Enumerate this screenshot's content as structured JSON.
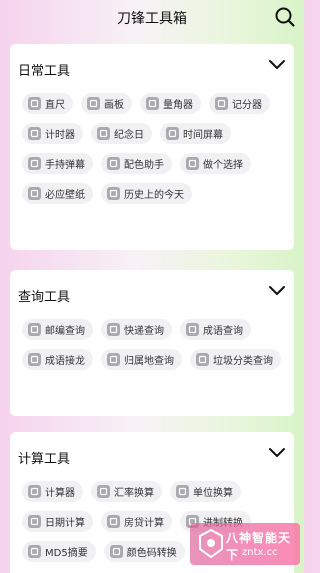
{
  "header": {
    "title": "刀锋工具箱",
    "search_icon": "search-icon"
  },
  "sections": {
    "daily": {
      "title": "日常工具",
      "items": [
        {
          "label": "直尺",
          "icon": "ruler-icon"
        },
        {
          "label": "画板",
          "icon": "palette-icon"
        },
        {
          "label": "量角器",
          "icon": "protractor-icon"
        },
        {
          "label": "记分器",
          "icon": "scoreboard-icon"
        },
        {
          "label": "计时器",
          "icon": "timer-icon"
        },
        {
          "label": "纪念日",
          "icon": "calendar-icon"
        },
        {
          "label": "时间屏幕",
          "icon": "clock-screen-icon"
        },
        {
          "label": "手持弹幕",
          "icon": "scrolling-text-icon"
        },
        {
          "label": "配色助手",
          "icon": "color-palette-icon"
        },
        {
          "label": "做个选择",
          "icon": "choice-icon"
        },
        {
          "label": "必应壁纸",
          "icon": "wallpaper-icon"
        },
        {
          "label": "历史上的今天",
          "icon": "history-icon"
        }
      ]
    },
    "query": {
      "title": "查询工具",
      "items": [
        {
          "label": "邮编查询",
          "icon": "postcode-icon"
        },
        {
          "label": "快递查询",
          "icon": "delivery-icon"
        },
        {
          "label": "成语查询",
          "icon": "book-icon"
        },
        {
          "label": "成语接龙",
          "icon": "idiom-chain-icon"
        },
        {
          "label": "归属地查询",
          "icon": "location-icon"
        },
        {
          "label": "垃圾分类查询",
          "icon": "trash-icon"
        }
      ]
    },
    "calc": {
      "title": "计算工具",
      "items": [
        {
          "label": "计算器",
          "icon": "calculator-icon"
        },
        {
          "label": "汇率换算",
          "icon": "exchange-icon"
        },
        {
          "label": "单位换算",
          "icon": "unit-convert-icon"
        },
        {
          "label": "日期计算",
          "icon": "date-calc-icon"
        },
        {
          "label": "房贷计算",
          "icon": "mortgage-icon"
        },
        {
          "label": "进制转换",
          "icon": "base-convert-icon"
        },
        {
          "label": "MD5摘要",
          "icon": "md5-icon"
        },
        {
          "label": "颜色码转换",
          "icon": "color-code-icon"
        }
      ]
    }
  },
  "watermark": {
    "name": "八神智能天下",
    "url": "zntx.cc"
  },
  "colors": {
    "chip_bg": "#f1f1f3",
    "icon_gray": "#a9aab0",
    "watermark": "#e25c9a"
  }
}
